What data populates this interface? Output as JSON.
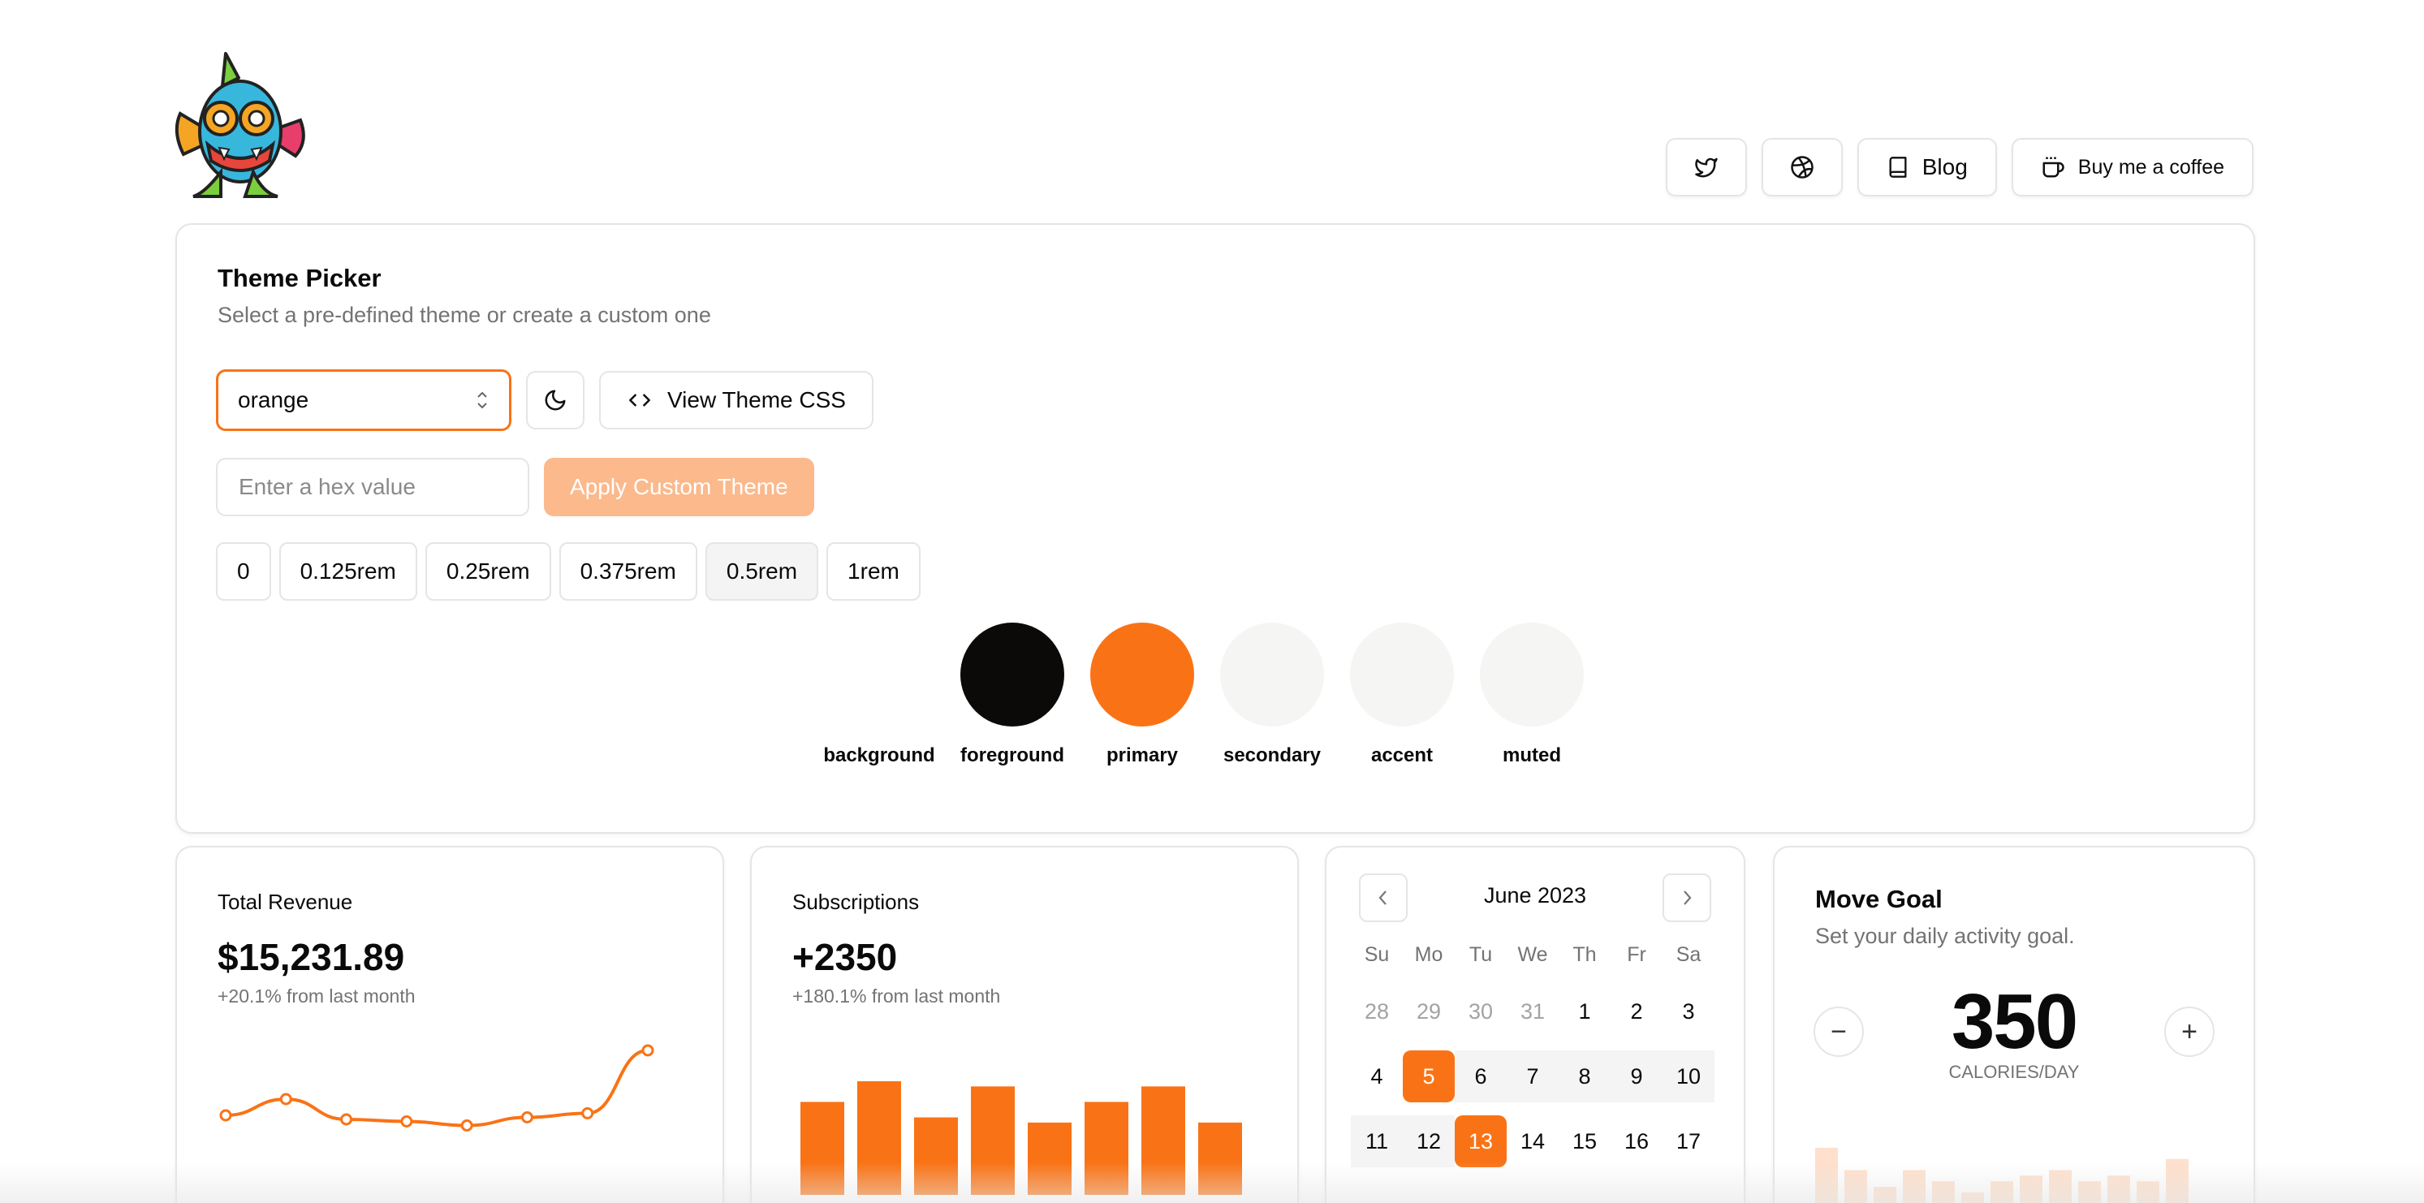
{
  "header": {
    "nav": [
      {
        "name": "twitter-icon",
        "label": ""
      },
      {
        "name": "dribbble-icon",
        "label": ""
      },
      {
        "name": "book-icon",
        "label": "Blog"
      },
      {
        "name": "coffee-icon",
        "label": "Buy me a coffee"
      }
    ]
  },
  "theme_picker": {
    "title": "Theme Picker",
    "subtitle": "Select a pre-defined theme or create a custom one",
    "selected_theme": "orange",
    "view_css_label": "View Theme CSS",
    "hex_placeholder": "Enter a hex value",
    "apply_label": "Apply Custom Theme",
    "radius_options": [
      "0",
      "0.125rem",
      "0.25rem",
      "0.375rem",
      "0.5rem",
      "1rem"
    ],
    "selected_radius": "0.5rem",
    "swatches": [
      {
        "label": "background",
        "color": "#ffffff"
      },
      {
        "label": "foreground",
        "color": "#0c0a09"
      },
      {
        "label": "primary",
        "color": "#f97316"
      },
      {
        "label": "secondary",
        "color": "#f5f5f4"
      },
      {
        "label": "accent",
        "color": "#f5f5f4"
      },
      {
        "label": "muted",
        "color": "#f5f5f4"
      }
    ]
  },
  "revenue": {
    "title": "Total Revenue",
    "value": "$15,231.89",
    "change": "+20.1% from last month"
  },
  "subscriptions": {
    "title": "Subscriptions",
    "value": "+2350",
    "change": "+180.1% from last month"
  },
  "calendar": {
    "month": "June 2023",
    "weekdays": [
      "Su",
      "Mo",
      "Tu",
      "We",
      "Th",
      "Fr",
      "Sa"
    ],
    "weeks": [
      [
        "28",
        "29",
        "30",
        "31",
        "1",
        "2",
        "3"
      ],
      [
        "4",
        "5",
        "6",
        "7",
        "8",
        "9",
        "10"
      ],
      [
        "11",
        "12",
        "13",
        "14",
        "15",
        "16",
        "17"
      ]
    ]
  },
  "goal": {
    "title": "Move Goal",
    "subtitle": "Set your daily activity goal.",
    "value": "350",
    "unit": "CALORIES/DAY",
    "minus": "−",
    "plus": "+"
  },
  "colors": {
    "primary": "#f97316",
    "primary_light": "#fbb98c",
    "border": "#e5e5e5"
  },
  "chart_data": [
    {
      "type": "line",
      "series": [
        {
          "values": [
            10,
            14,
            9,
            8.5,
            7.5,
            9.5,
            10.5,
            26
          ]
        }
      ]
    },
    {
      "type": "bar",
      "series": [
        {
          "values": [
            18,
            22,
            15,
            21,
            14,
            18,
            21,
            14
          ]
        }
      ]
    },
    {
      "type": "bar",
      "series": [
        {
          "values": [
            16,
            12,
            9,
            12,
            10,
            8,
            10,
            11,
            12,
            10,
            11,
            10,
            14
          ]
        }
      ]
    }
  ]
}
